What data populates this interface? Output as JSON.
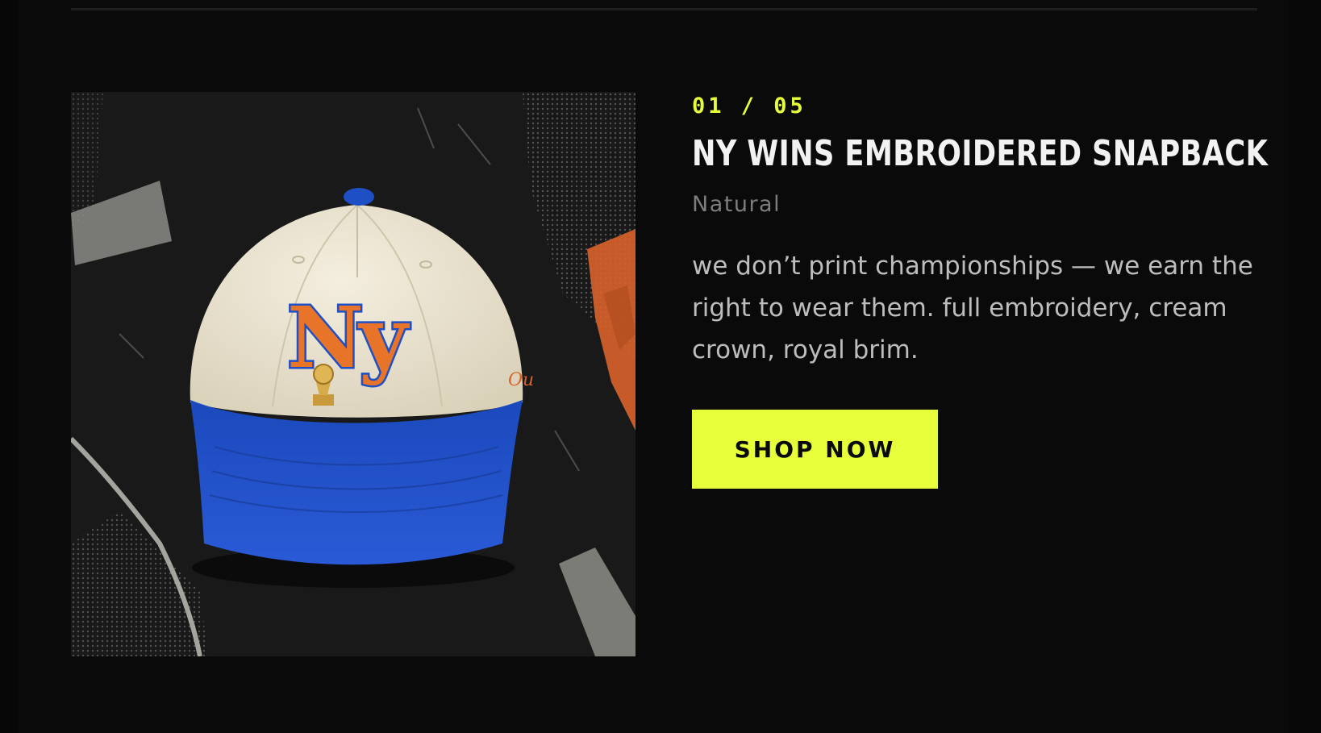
{
  "product": {
    "counter": "01 / 05",
    "title": "NY WINS EMBROIDERED SNAPBACK",
    "variant": "Natural",
    "description": "we don’t print championships — we earn the right to wear them. full embroidery, cream crown, royal brim.",
    "shop_label": "SHOP NOW",
    "image": {
      "logo_text": "Ny",
      "side_text": "Ou"
    }
  },
  "colors": {
    "background": "#0a0a0a",
    "accent": "#e6ff3a",
    "title": "#f2f2f2",
    "variant": "#7d7d7d",
    "body_text": "#bdbdbd",
    "cap_crown": "#ece4cf",
    "cap_brim": "#1f4fc4",
    "logo_orange": "#e8742a"
  }
}
